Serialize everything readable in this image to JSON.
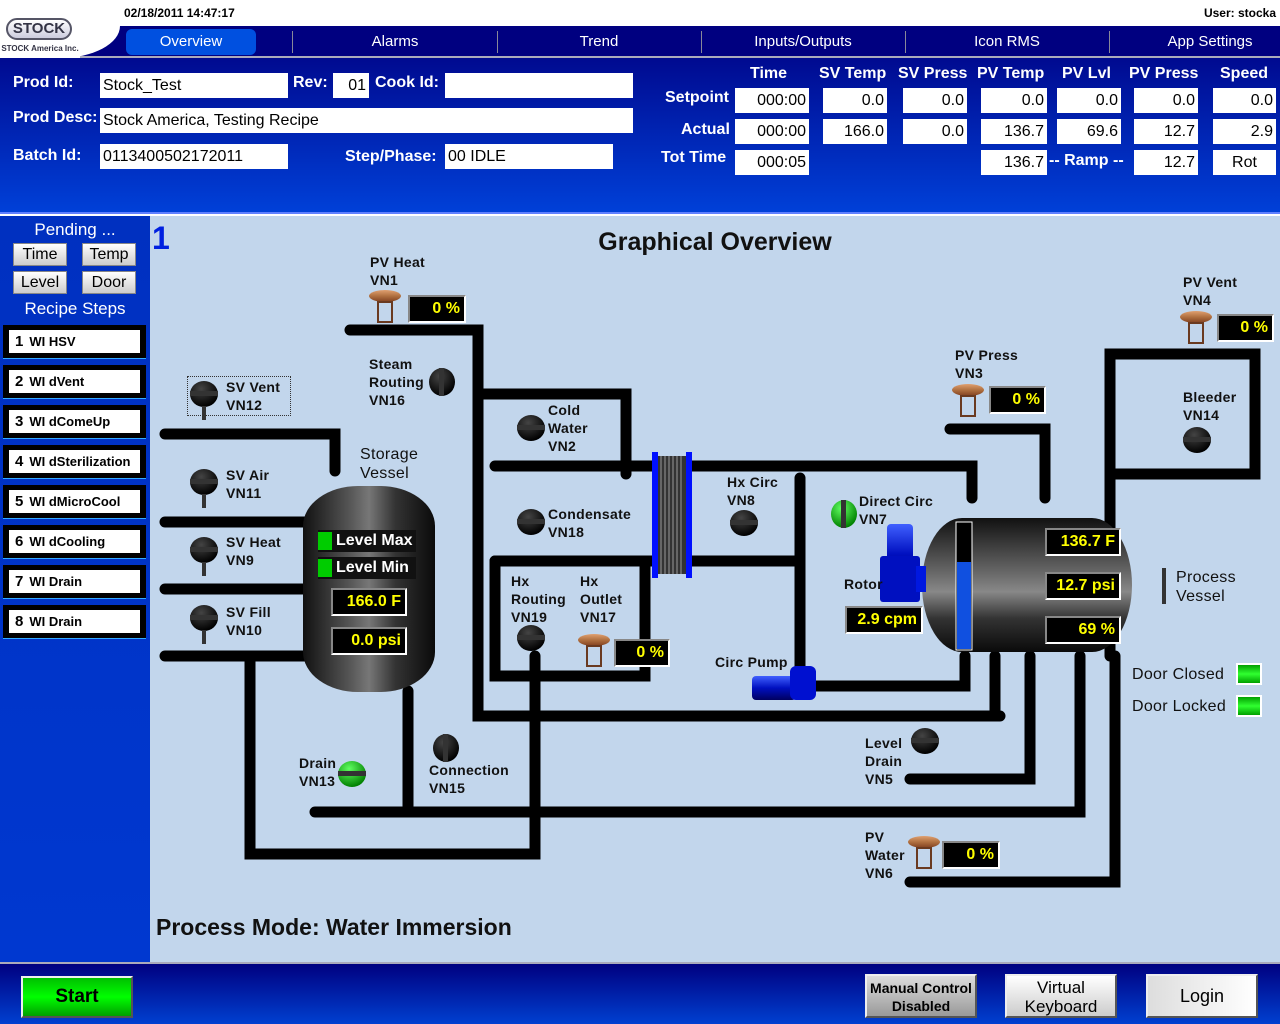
{
  "app": {
    "datetime": "02/18/2011 14:47:17",
    "user": "User: stocka",
    "logo": {
      "name": "STOCK",
      "subtitle": "STOCK America Inc."
    }
  },
  "nav": {
    "tabs": [
      {
        "label": "Overview",
        "active": true
      },
      {
        "label": "Alarms"
      },
      {
        "label": "Trend"
      },
      {
        "label": "Inputs/Outputs"
      },
      {
        "label": "Icon RMS"
      },
      {
        "label": "App Settings"
      }
    ]
  },
  "header": {
    "prod_id_label": "Prod Id:",
    "prod_id": "Stock_Test",
    "rev_label": "Rev:",
    "rev": "01",
    "cook_id_label": "Cook Id:",
    "cook_id": "",
    "prod_desc_label": "Prod Desc:",
    "prod_desc": "Stock America, Testing Recipe",
    "batch_id_label": "Batch Id:",
    "batch_id": "0113400502172011",
    "step_phase_label": "Step/Phase:",
    "step_phase": "00 IDLE",
    "columns": [
      "Time",
      "SV Temp",
      "SV Press",
      "PV Temp",
      "PV Lvl",
      "PV Press",
      "Speed"
    ],
    "rows": {
      "setpoint_label": "Setpoint",
      "setpoint": [
        "000:00",
        "0.0",
        "0.0",
        "0.0",
        "0.0",
        "0.0",
        "0.0"
      ],
      "actual_label": "Actual",
      "actual": [
        "000:00",
        "166.0",
        "0.0",
        "136.7",
        "69.6",
        "12.7",
        "2.9"
      ],
      "tot_time_label": "Tot Time",
      "tot_time": "000:05",
      "ramp_pv_temp": "136.7",
      "ramp_label": "-- Ramp --",
      "ramp_pv_press": "12.7",
      "speed_mode": "Rot"
    }
  },
  "sidebar": {
    "pending_title": "Pending ...",
    "pending_buttons": [
      "Time",
      "Temp",
      "Level",
      "Door"
    ],
    "recipe_title": "Recipe Steps",
    "steps": [
      {
        "num": "1",
        "name": "WI HSV"
      },
      {
        "num": "2",
        "name": "WI dVent"
      },
      {
        "num": "3",
        "name": "WI dComeUp"
      },
      {
        "num": "4",
        "name": "WI dSterilization"
      },
      {
        "num": "5",
        "name": "WI dMicroCool"
      },
      {
        "num": "6",
        "name": "WI dCooling"
      },
      {
        "num": "7",
        "name": "WI Drain"
      },
      {
        "num": "8",
        "name": "WI Drain"
      }
    ]
  },
  "overview": {
    "step_number": "1",
    "title": "Graphical Overview",
    "process_mode_label": "Process Mode:",
    "process_mode": "Water Immersion",
    "valves": {
      "vn1": {
        "name": "PV Heat",
        "id": "VN1",
        "percent": "0 %"
      },
      "vn16": {
        "name1": "Steam",
        "name2": "Routing",
        "id": "VN16"
      },
      "vn12": {
        "name": "SV Vent",
        "id": "VN12"
      },
      "vn2": {
        "name1": "Cold",
        "name2": "Water",
        "id": "VN2"
      },
      "vn11": {
        "name": "SV Air",
        "id": "VN11"
      },
      "vn9": {
        "name": "SV Heat",
        "id": "VN9"
      },
      "vn10": {
        "name": "SV Fill",
        "id": "VN10"
      },
      "vn18": {
        "name": "Condensate",
        "id": "VN18"
      },
      "vn19": {
        "name1": "Hx",
        "name2": "Routing",
        "id": "VN19"
      },
      "vn17": {
        "name1": "Hx",
        "name2": "Outlet",
        "id": "VN17",
        "percent": "0 %"
      },
      "vn8": {
        "name": "Hx Circ",
        "id": "VN8"
      },
      "vn7": {
        "name": "Direct Circ",
        "id": "VN7"
      },
      "vn3": {
        "name": "PV Press",
        "id": "VN3",
        "percent": "0 %"
      },
      "vn4": {
        "name": "PV Vent",
        "id": "VN4",
        "percent": "0 %"
      },
      "vn14": {
        "name": "Bleeder",
        "id": "VN14"
      },
      "vn5": {
        "name1": "Level",
        "name2": "Drain",
        "id": "VN5"
      },
      "vn6": {
        "name1": "PV",
        "name2": "Water",
        "id": "VN6",
        "percent": "0 %"
      },
      "vn13": {
        "name": "Drain",
        "id": "VN13"
      },
      "vn15": {
        "name": "Connection",
        "id": "VN15"
      }
    },
    "storage_vessel": {
      "label1": "Storage",
      "label2": "Vessel",
      "level_max": "Level Max",
      "level_min": "Level Min",
      "temp": "166.0 F",
      "press": "0.0 psi"
    },
    "process_vessel": {
      "label1": "Process",
      "label2": "Vessel",
      "temp": "136.7 F",
      "press": "12.7 psi",
      "level": "69 %",
      "level_fraction": 0.69
    },
    "rotor": {
      "label": "Rotor",
      "speed": "2.9 cpm"
    },
    "circ_pump": {
      "label": "Circ Pump"
    },
    "door_closed": "Door Closed",
    "door_locked": "Door Locked",
    "colors": {
      "valve_open": "#10c010",
      "valve_closed": "#111111",
      "display_text": "#ffff00",
      "indicator_on": "#00e000"
    }
  },
  "footer": {
    "start": "Start",
    "manual_control_line1": "Manual Control",
    "manual_control_line2": "Disabled",
    "virtual_keyboard_line1": "Virtual",
    "virtual_keyboard_line2": "Keyboard",
    "login": "Login"
  }
}
